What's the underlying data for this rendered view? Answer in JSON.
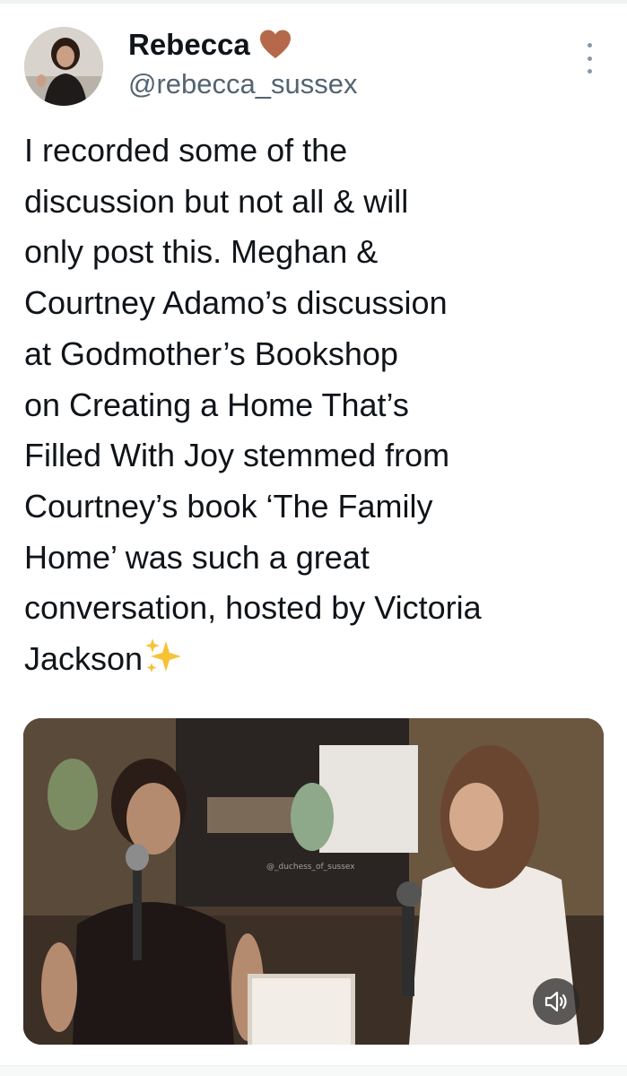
{
  "tweet": {
    "author": {
      "display_name": "Rebecca",
      "badge_icon": "brown-heart-emoji",
      "handle": "@rebecca_sussex"
    },
    "text": "I recorded some of the\ndiscussion but not all & will\nonly post this. Meghan &\nCourtney Adamo’s discussion\nat Godmother’s Bookshop\non Creating a Home That’s\nFilled With Joy stemmed from\nCourtney’s book ‘The Family\nHome’ was such a great\nconversation, hosted by Victoria\nJackson",
    "text_end_icon": "sparkles-emoji",
    "media": {
      "watermark": "@_duchess_of_sussex",
      "volume_icon": "speaker-volume-icon"
    },
    "more_icon": "more-options-icon"
  },
  "colors": {
    "text": "#0f1419",
    "secondary": "#536471",
    "heart": "#b5694a"
  }
}
